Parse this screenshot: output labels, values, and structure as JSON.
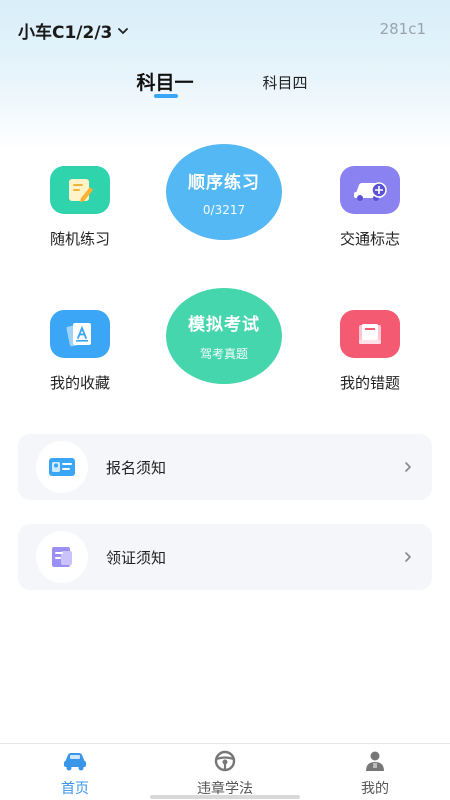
{
  "header": {
    "vehicle_type": "小车C1/2/3",
    "code": "281c1"
  },
  "tabs": [
    {
      "label": "科目一",
      "active": true
    },
    {
      "label": "科目四",
      "active": false
    }
  ],
  "grid": {
    "random_practice": "随机练习",
    "sequential": {
      "title": "顺序练习",
      "progress": "0/3217"
    },
    "traffic_signs": "交通标志",
    "favorites": "我的收藏",
    "mock_exam": {
      "title": "模拟考试",
      "subtitle": "驾考真题"
    },
    "wrong_questions": "我的错题"
  },
  "cards": [
    {
      "label": "报名须知",
      "icon": "id-card-icon"
    },
    {
      "label": "领证须知",
      "icon": "document-icon"
    }
  ],
  "bottom_nav": [
    {
      "label": "首页",
      "icon": "car-icon",
      "active": true
    },
    {
      "label": "违章学法",
      "icon": "steering-wheel-icon",
      "active": false
    },
    {
      "label": "我的",
      "icon": "user-icon",
      "active": false
    }
  ],
  "colors": {
    "accent": "#3a96e9",
    "sequential_circle": "#53b8f3",
    "mock_circle": "#45d6ae",
    "random_icon_bg": "#2fd4ad",
    "traffic_icon_bg": "#8a82f0",
    "favorites_icon_bg": "#3aa6f5",
    "wrong_icon_bg": "#f45a72"
  }
}
